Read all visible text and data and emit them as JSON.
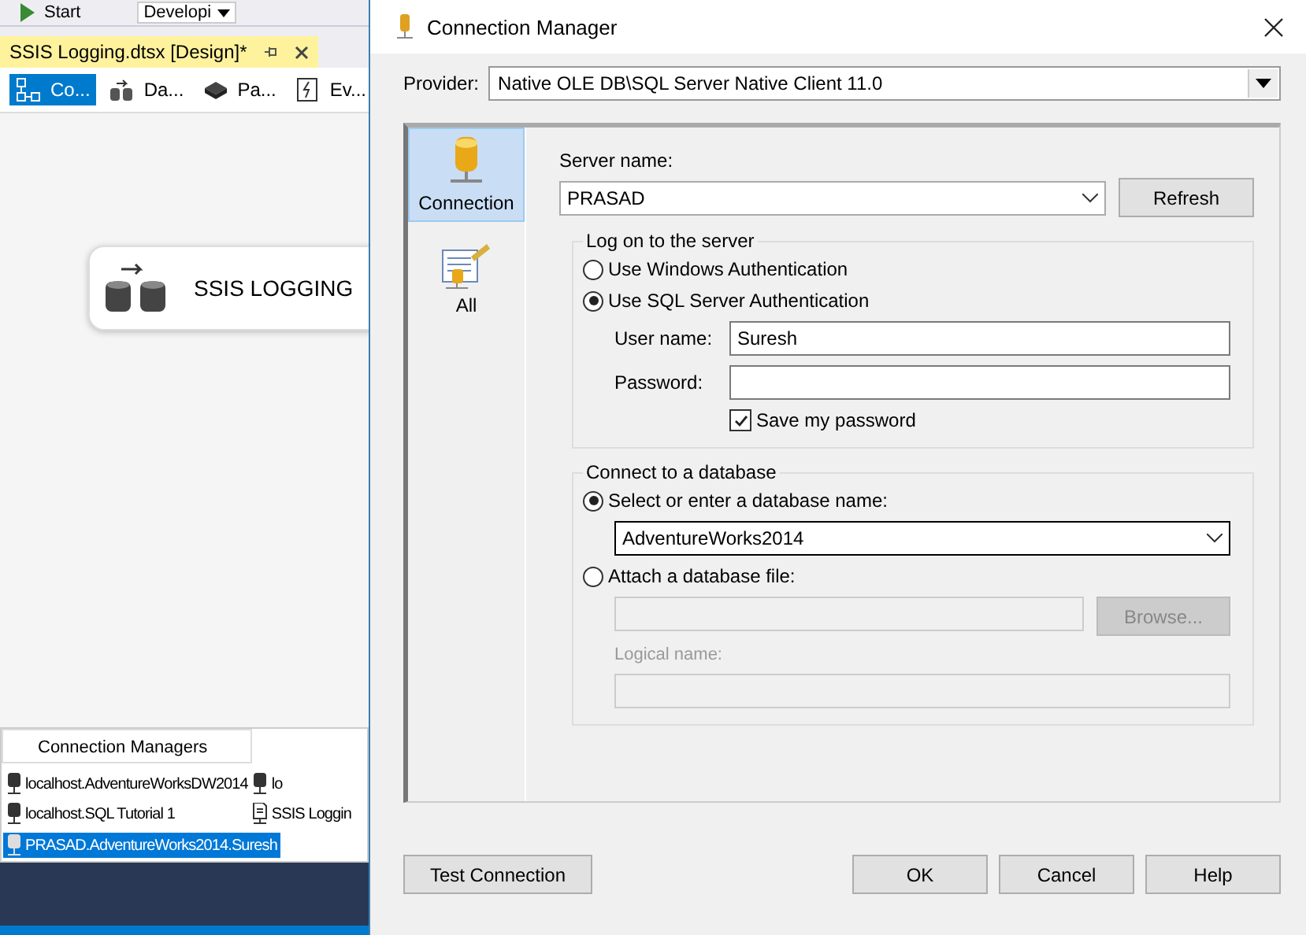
{
  "toolbar": {
    "start_label": "Start",
    "config_value": "Developi"
  },
  "document_tab": {
    "title": "SSIS Logging.dtsx [Design]*"
  },
  "designer_tabs": [
    {
      "label": "Co...",
      "selected": true,
      "kind": "control"
    },
    {
      "label": "Da...",
      "selected": false,
      "kind": "data"
    },
    {
      "label": "Pa...",
      "selected": false,
      "kind": "param"
    },
    {
      "label": "Ev...",
      "selected": false,
      "kind": "event"
    }
  ],
  "canvas": {
    "task_label": "SSIS LOGGING"
  },
  "connection_managers": {
    "title": "Connection Managers",
    "items": [
      {
        "label": "localhost.AdventureWorksDW2014",
        "kind": "database",
        "selected": false
      },
      {
        "label": "lo",
        "kind": "database",
        "selected": false
      },
      {
        "label": "localhost.SQL Tutorial 1",
        "kind": "database",
        "selected": false
      },
      {
        "label": "SSIS Loggin",
        "kind": "file",
        "selected": false
      },
      {
        "label": "PRASAD.AdventureWorks2014.Suresh",
        "kind": "database",
        "selected": true
      }
    ]
  },
  "dialog": {
    "title": "Connection Manager",
    "provider_label": "Provider:",
    "provider_value": "Native OLE DB\\SQL Server Native Client 11.0",
    "nav": [
      {
        "label": "Connection",
        "selected": true,
        "kind": "connection"
      },
      {
        "label": "All",
        "selected": false,
        "kind": "all"
      }
    ],
    "server_label": "Server name:",
    "server_value": "PRASAD",
    "refresh_button": "Refresh",
    "logon_legend": "Log on to the server",
    "auth_options": [
      {
        "label": "Use Windows Authentication",
        "selected": false
      },
      {
        "label": "Use SQL Server Authentication",
        "selected": true
      }
    ],
    "user_label": "User name:",
    "user_value": "Suresh",
    "password_label": "Password:",
    "save_password": {
      "label": "Save my password",
      "checked": true
    },
    "database_legend": "Connect to a database",
    "database_options": [
      {
        "label": "Select or enter a database name:",
        "selected": true
      },
      {
        "label": "Attach a database file:",
        "selected": false
      }
    ],
    "database_value": "AdventureWorks2014",
    "browse_button": "Browse...",
    "browse_disabled": true,
    "logical_label": "Logical name:",
    "buttons": {
      "test": "Test Connection",
      "ok": "OK",
      "cancel": "Cancel",
      "help": "Help"
    }
  }
}
